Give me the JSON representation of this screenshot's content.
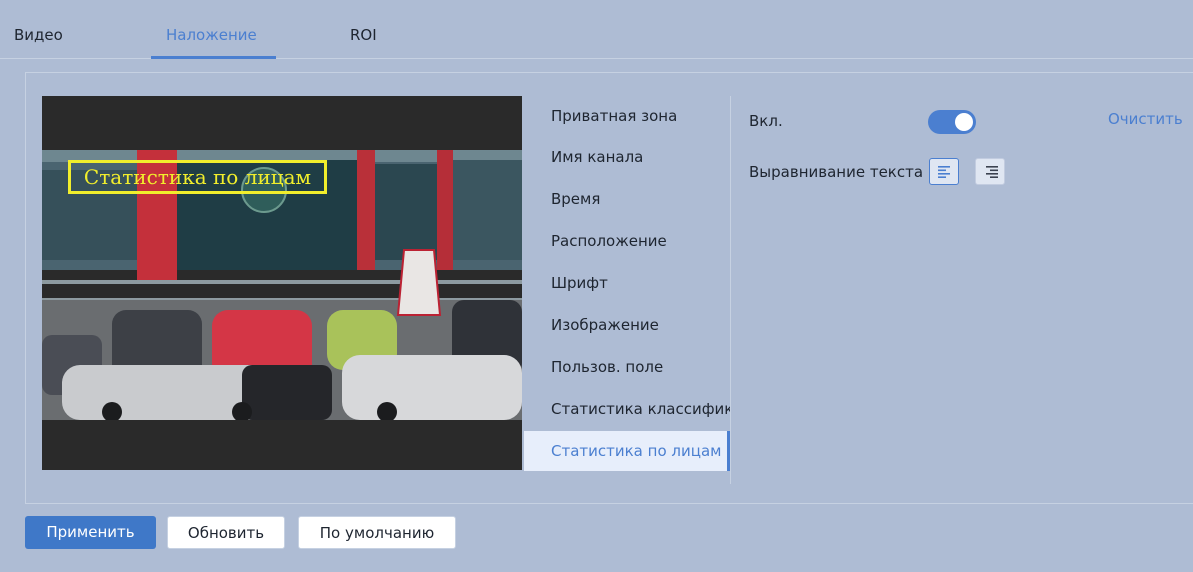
{
  "tabs": [
    {
      "label": "Видео"
    },
    {
      "label": "Наложение",
      "active": true
    },
    {
      "label": "ROI"
    }
  ],
  "preview": {
    "overlay_text": "Статистика по лицам",
    "overlay_color": "#f1ee2c"
  },
  "menu": {
    "items": [
      {
        "label": "Приватная зона"
      },
      {
        "label": "Имя канала"
      },
      {
        "label": "Время"
      },
      {
        "label": "Расположение"
      },
      {
        "label": "Шрифт"
      },
      {
        "label": "Изображение"
      },
      {
        "label": "Пользов. поле"
      },
      {
        "label": "Статистика классифика..."
      },
      {
        "label": "Статистика по лицам",
        "active": true
      }
    ]
  },
  "settings": {
    "enable_label": "Вкл.",
    "enable_on": true,
    "clear_label": "Очистить",
    "align_label": "Выравнивание текста",
    "align_options": [
      "align-left-icon",
      "align-right-icon"
    ],
    "align_selected": "align-left-icon"
  },
  "buttons": {
    "apply": "Применить",
    "refresh": "Обновить",
    "default": "По умолчанию"
  },
  "colors": {
    "accent": "#4b7fd0",
    "background": "#aebcd4"
  }
}
